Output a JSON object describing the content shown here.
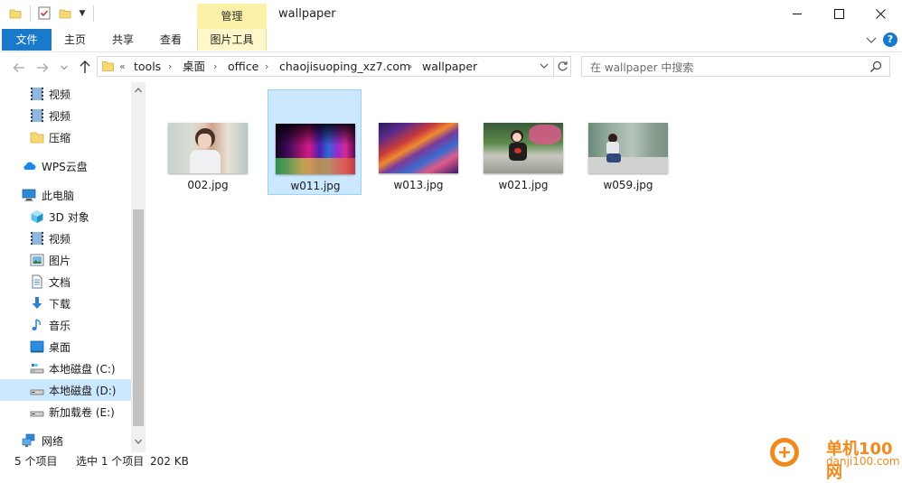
{
  "window": {
    "title": "wallpaper",
    "contextual_tab_group": "管理"
  },
  "ribbon": {
    "tabs": [
      "文件",
      "主页",
      "共享",
      "查看",
      "图片工具"
    ],
    "help": "?"
  },
  "address": {
    "overflow": "«",
    "crumbs": [
      "tools",
      "桌面",
      "office",
      "chaojisuoping_xz7.com",
      "wallpaper"
    ],
    "search_placeholder": "在 wallpaper 中搜索"
  },
  "nav": {
    "items": [
      {
        "label": "视频",
        "icon": "video-icon"
      },
      {
        "label": "视频",
        "icon": "video-icon"
      },
      {
        "label": "压缩",
        "icon": "folder-icon"
      },
      {
        "label": "WPS云盘",
        "icon": "cloud-icon"
      },
      {
        "label": "此电脑",
        "icon": "computer-icon"
      },
      {
        "label": "3D 对象",
        "icon": "3d-objects-icon"
      },
      {
        "label": "视频",
        "icon": "video-icon"
      },
      {
        "label": "图片",
        "icon": "pictures-icon"
      },
      {
        "label": "文档",
        "icon": "documents-icon"
      },
      {
        "label": "下载",
        "icon": "download-icon"
      },
      {
        "label": "音乐",
        "icon": "music-icon"
      },
      {
        "label": "桌面",
        "icon": "desktop-icon"
      },
      {
        "label": "本地磁盘 (C:)",
        "icon": "drive-c-icon"
      },
      {
        "label": "本地磁盘 (D:)",
        "icon": "drive-icon",
        "selected": true
      },
      {
        "label": "新加载卷 (E:)",
        "icon": "drive-icon"
      },
      {
        "label": "网络",
        "icon": "network-icon"
      }
    ]
  },
  "files": [
    {
      "name": "002.jpg",
      "selected": false
    },
    {
      "name": "w011.jpg",
      "selected": true
    },
    {
      "name": "w013.jpg",
      "selected": false
    },
    {
      "name": "w021.jpg",
      "selected": false
    },
    {
      "name": "w059.jpg",
      "selected": false
    }
  ],
  "status": {
    "count": "5 个项目",
    "selection": "选中 1 个项目",
    "size": "202 KB"
  },
  "watermark": {
    "line1": "单机100网",
    "line2": "danji100.com"
  },
  "colors": {
    "accent": "#1979ca",
    "selection": "#cce8ff",
    "contextual": "#fbf2a8"
  }
}
